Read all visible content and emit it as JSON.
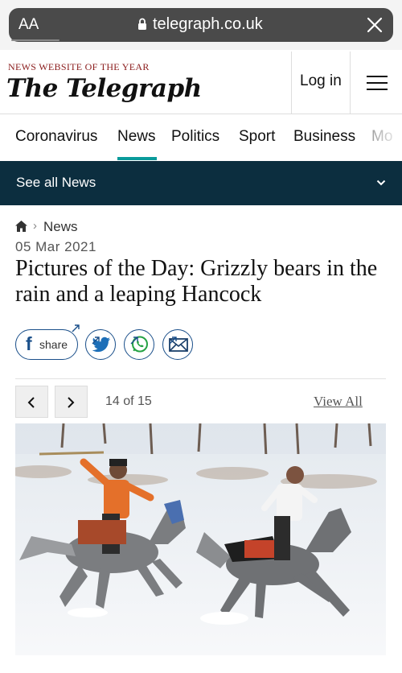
{
  "browser": {
    "aa_label": "AA",
    "url": "telegraph.co.uk"
  },
  "masthead": {
    "award": "NEWS WEBSITE OF THE YEAR",
    "logo": "The Telegraph",
    "login_label": "Log in"
  },
  "nav": {
    "items": [
      "Coronavirus",
      "News",
      "Politics",
      "Sport",
      "Business",
      "Mo"
    ],
    "active": "News"
  },
  "section": {
    "label": "See all News"
  },
  "article": {
    "breadcrumb": "News",
    "date": "05 Mar 2021",
    "headline": "Pictures of the Day: Grizzly bears in the rain and a leaping Hancock"
  },
  "share": {
    "facebook_label": "share"
  },
  "gallery": {
    "counter": "14 of 15",
    "view_all": "View All",
    "current": 14,
    "total": 15
  },
  "colors": {
    "accent_teal": "#0a9b9b",
    "section_bar": "#0c2e3f",
    "share_blue": "#1a4f8a",
    "whatsapp_green": "#25a244"
  }
}
